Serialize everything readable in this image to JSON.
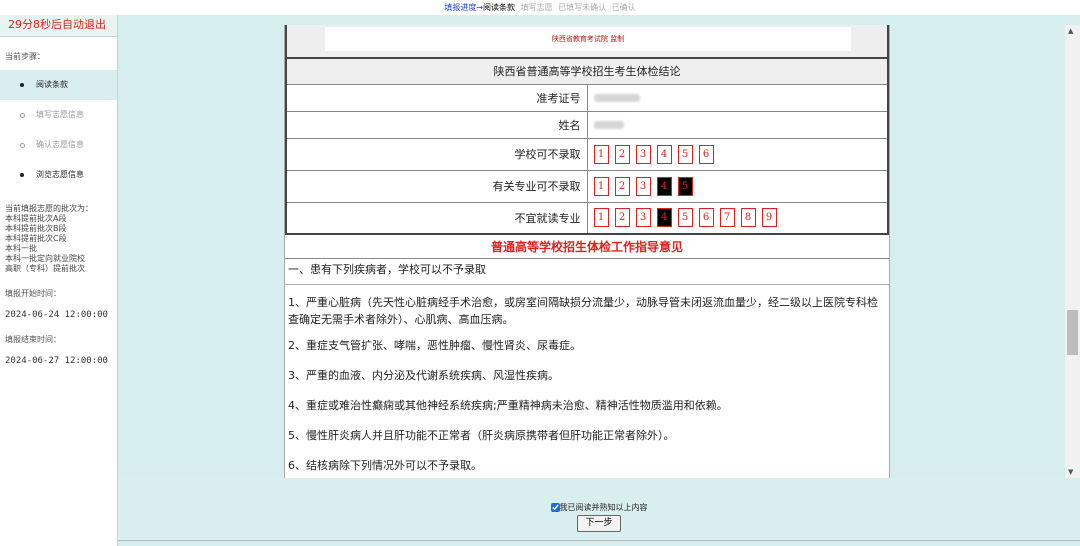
{
  "topbar": {
    "lead": "填报进度→",
    "current": "阅读条款",
    "steps": [
      "填写志愿",
      "已填写未确认",
      "已确认"
    ]
  },
  "sidebar": {
    "countdown": "29分8秒后自动退出",
    "steps_label": "当前步骤：",
    "steps": [
      {
        "label": "阅读条款"
      },
      {
        "label": "填写志愿信息"
      },
      {
        "label": "确认志愿信息"
      },
      {
        "label": "浏览志愿信息"
      }
    ],
    "batches_head": "当前填报志愿的批次为：",
    "batches": [
      "本科提前批次A段",
      "本科提前批次B段",
      "本科提前批次C段",
      "本科一批",
      "本科一批定向就业院校",
      "高职（专科）提前批次"
    ],
    "start_label": "填报开始时间：",
    "start_value": "2024-06-24 12:00:00",
    "end_label": "填报结束时间：",
    "end_value": "2024-06-27 12:00:00"
  },
  "doc": {
    "stamp_text": "陕西省教育考试院  监制",
    "table_title": "陕西省普通高等学校招生考生体检结论",
    "rows": {
      "exam_no": "准考证号",
      "name": "姓名",
      "school_reject": "学校可不录取",
      "major_reject": "有关专业可不录取",
      "unsuitable": "不宜就读专业"
    },
    "school_nums": [
      "1",
      "2",
      "3",
      "4",
      "5",
      "6"
    ],
    "major_nums": [
      "1",
      "2",
      "3",
      "4",
      "5"
    ],
    "unsuit_nums": [
      "1",
      "2",
      "3",
      "4",
      "5",
      "6",
      "7",
      "8",
      "9"
    ],
    "guide_title": "普通高等学校招生体检工作指导意见",
    "paragraphs": [
      "一、患有下列疾病者，学校可以不予录取",
      "1、严重心脏病（先天性心脏病经手术治愈，或房室间隔缺损分流量少，动脉导管未闭返流血量少，经二级以上医院专科检查确定无需手术者除外）、心肌病、高血压病。",
      "2、重症支气管扩张、哮喘，恶性肿瘤、慢性肾炎、尿毒症。",
      "3、严重的血液、内分泌及代谢系统疾病、风湿性疾病。",
      "4、重症或难治性癫痫或其他神经系统疾病;严重精神病未治愈、精神活性物质滥用和依赖。",
      "5、慢性肝炎病人并且肝功能不正常者（肝炎病原携带者但肝功能正常者除外）。",
      "6、结核病除下列情况外可以不予录取。"
    ]
  },
  "footer": {
    "agree_text": "我已阅读并熟知以上内容",
    "next_label": "下一步"
  }
}
